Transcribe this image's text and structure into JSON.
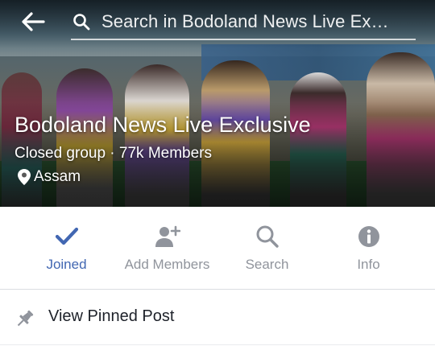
{
  "header": {
    "search_placeholder": "Search in Bodoland News Live Ex…",
    "back_icon": "back-arrow-icon",
    "search_icon": "search-icon"
  },
  "group": {
    "name": "Bodoland News Live Exclusive",
    "meta": "Closed group · 77k Members",
    "location": "Assam"
  },
  "actions": [
    {
      "label": "Joined",
      "icon": "checkmark-icon",
      "active": true
    },
    {
      "label": "Add Members",
      "icon": "add-person-icon",
      "active": false
    },
    {
      "label": "Search",
      "icon": "search-icon",
      "active": false
    },
    {
      "label": "Info",
      "icon": "info-icon",
      "active": false
    }
  ],
  "pinned": {
    "label": "View Pinned Post",
    "icon": "pushpin-icon"
  },
  "colors": {
    "accent": "#4267b2",
    "inactive": "#90949c",
    "text": "#1d2129"
  }
}
